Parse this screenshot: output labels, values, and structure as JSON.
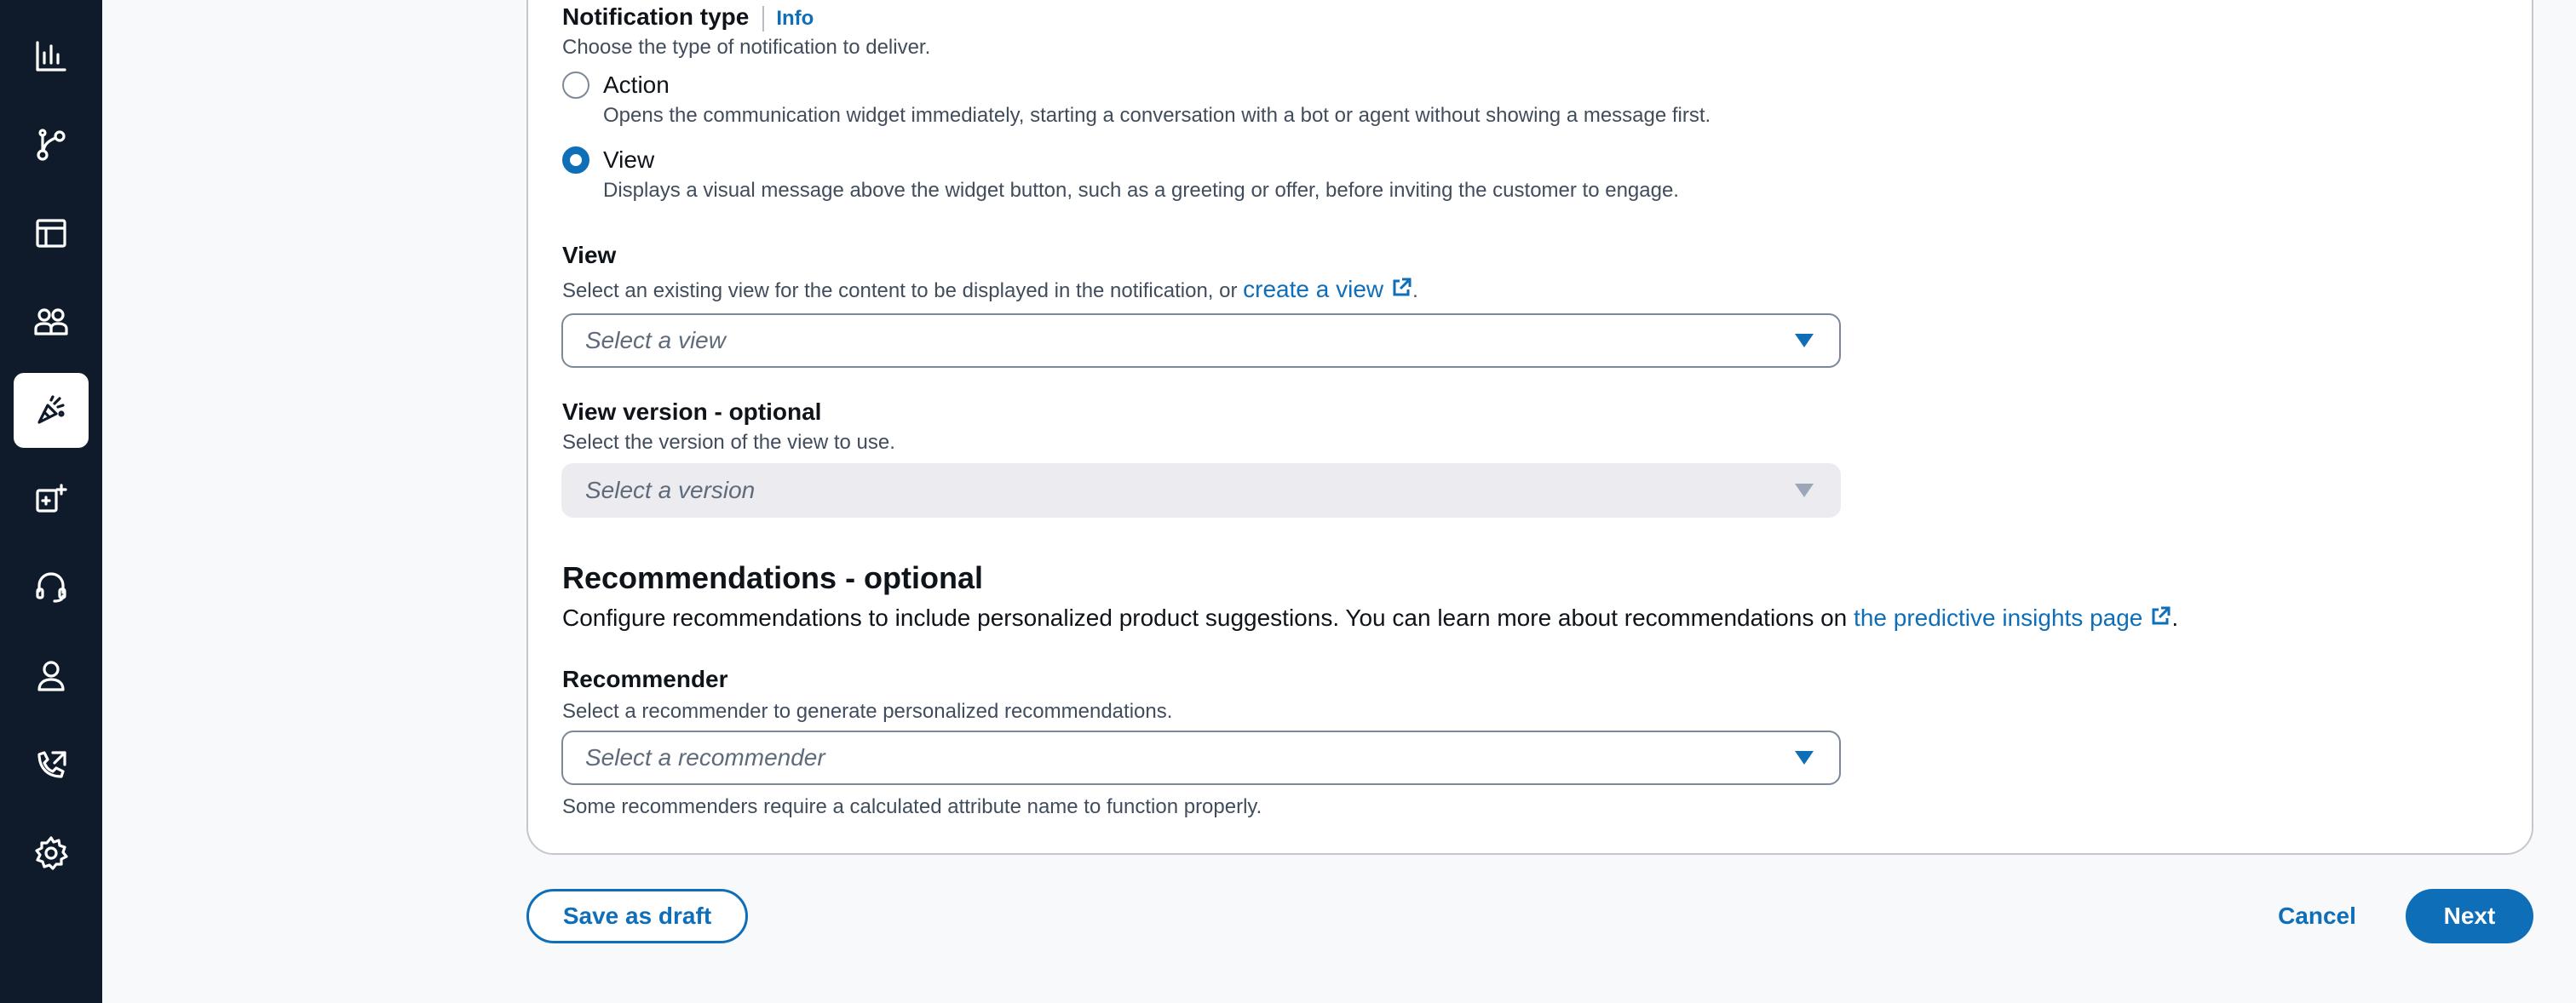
{
  "notification_type": {
    "label": "Notification type",
    "info_link": "Info",
    "description": "Choose the type of notification to deliver.",
    "options": [
      {
        "label": "Action",
        "description": "Opens the communication widget immediately, starting a conversation with a bot or agent without showing a message first.",
        "selected": false
      },
      {
        "label": "View",
        "description": "Displays a visual message above the widget button, such as a greeting or offer, before inviting the customer to engage.",
        "selected": true
      }
    ]
  },
  "view": {
    "label": "View",
    "description_prefix": "Select an existing view for the content to be displayed in the notification, or ",
    "link_text": "create a view",
    "description_suffix": ".",
    "placeholder": "Select a view"
  },
  "view_version": {
    "label": "View version - optional",
    "description": "Select the version of the view to use.",
    "placeholder": "Select a version",
    "disabled": true
  },
  "recommendations": {
    "heading": "Recommendations - optional",
    "description_prefix": "Configure recommendations to include personalized product suggestions. You can learn more about recommendations on ",
    "link_text": "the predictive insights page",
    "description_suffix": "."
  },
  "recommender": {
    "label": "Recommender",
    "description": "Select a recommender to generate personalized recommendations.",
    "placeholder": "Select a recommender",
    "hint": "Some recommenders require a calculated attribute name to function properly."
  },
  "footer": {
    "save_draft": "Save as draft",
    "cancel": "Cancel",
    "next": "Next"
  },
  "sidebar": {
    "items": [
      {
        "icon": "bar-chart-icon",
        "active": false
      },
      {
        "icon": "flow-icon",
        "active": false
      },
      {
        "icon": "table-icon",
        "active": false
      },
      {
        "icon": "users-icon",
        "active": false
      },
      {
        "icon": "megaphone-icon",
        "active": true
      },
      {
        "icon": "add-widget-icon",
        "active": false
      },
      {
        "icon": "headset-icon",
        "active": false
      },
      {
        "icon": "user-icon",
        "active": false
      },
      {
        "icon": "phone-routing-icon",
        "active": false
      },
      {
        "icon": "settings-icon",
        "active": false
      }
    ]
  },
  "colors": {
    "accent": "#0f6eb8",
    "rail": "#0f1b2a"
  }
}
